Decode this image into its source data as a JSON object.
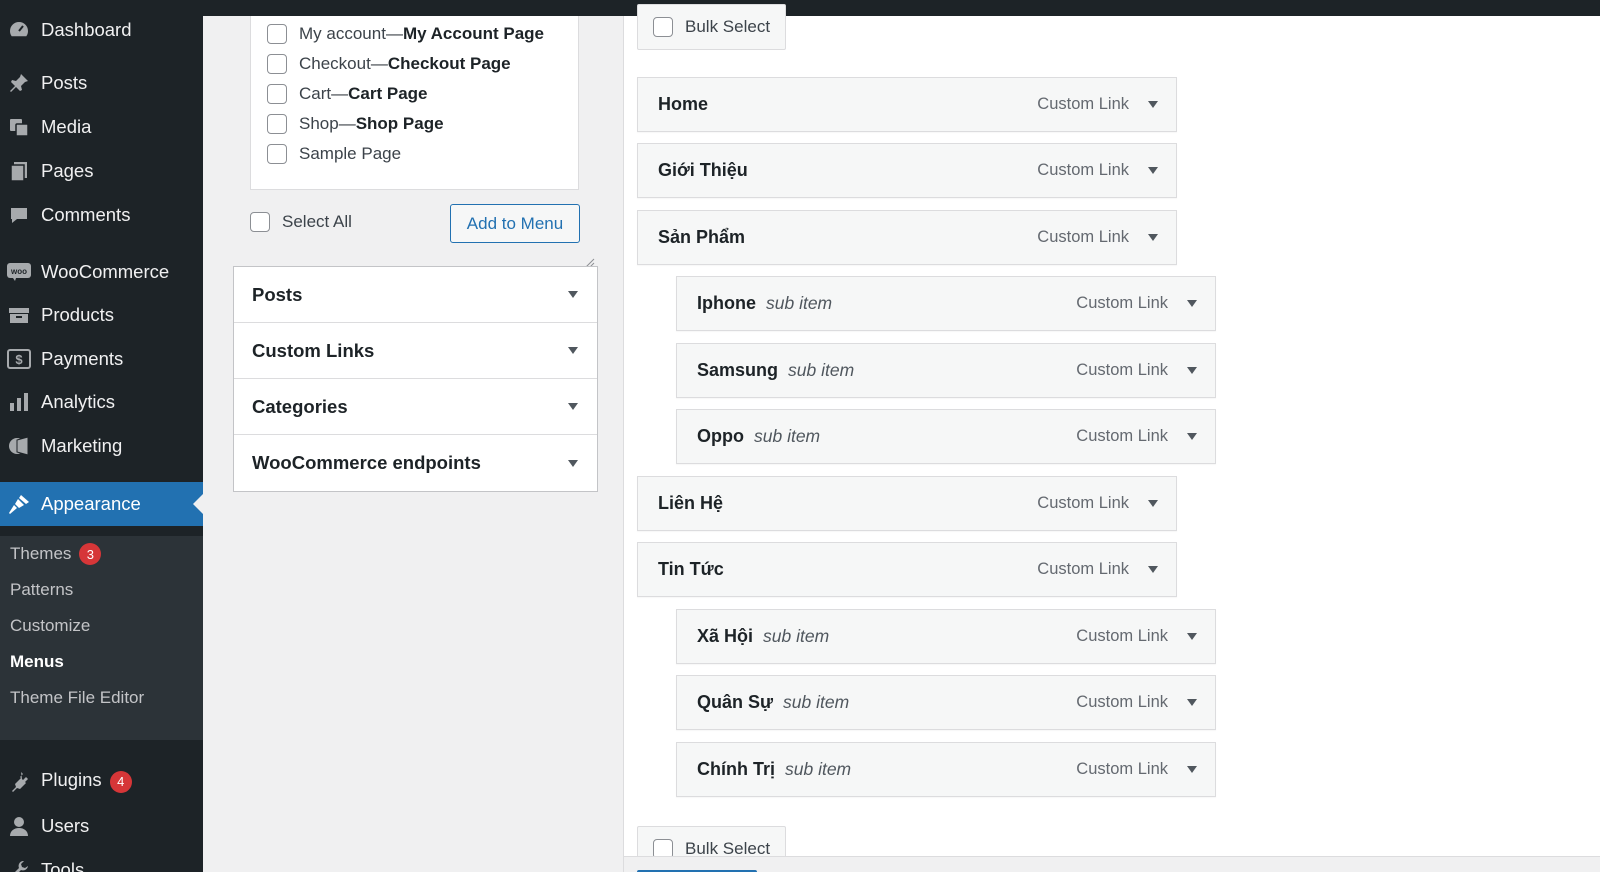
{
  "sidebar": {
    "items": [
      {
        "label": "Dashboard",
        "icon": "dashboard-icon"
      },
      {
        "label": "Posts",
        "icon": "pin-icon"
      },
      {
        "label": "Media",
        "icon": "media-icon"
      },
      {
        "label": "Pages",
        "icon": "pages-icon"
      },
      {
        "label": "Comments",
        "icon": "comment-icon"
      },
      {
        "label": "WooCommerce",
        "icon": "woo-icon"
      },
      {
        "label": "Products",
        "icon": "archive-icon"
      },
      {
        "label": "Payments",
        "icon": "dollar-icon"
      },
      {
        "label": "Analytics",
        "icon": "bar-chart-icon"
      },
      {
        "label": "Marketing",
        "icon": "megaphone-icon"
      },
      {
        "label": "Appearance",
        "icon": "brush-icon"
      },
      {
        "label": "Plugins",
        "icon": "plug-icon",
        "badge": "4"
      },
      {
        "label": "Users",
        "icon": "user-icon"
      },
      {
        "label": "Tools",
        "icon": "wrench-icon"
      }
    ],
    "submenu": [
      {
        "label": "Themes",
        "badge": "3"
      },
      {
        "label": "Patterns"
      },
      {
        "label": "Customize"
      },
      {
        "label": "Menus"
      },
      {
        "label": "Theme File Editor"
      }
    ]
  },
  "pages_panel": {
    "items": [
      {
        "name": "My account",
        "sep": " — ",
        "state": "My Account Page"
      },
      {
        "name": "Checkout",
        "sep": " — ",
        "state": "Checkout Page"
      },
      {
        "name": "Cart",
        "sep": " — ",
        "state": "Cart Page"
      },
      {
        "name": "Shop",
        "sep": " — ",
        "state": "Shop Page"
      },
      {
        "name": "Sample Page"
      }
    ],
    "select_all": "Select All",
    "add_button": "Add to Menu"
  },
  "accordion": [
    "Posts",
    "Custom Links",
    "Categories",
    "WooCommerce endpoints"
  ],
  "menu_structure": {
    "bulk_select": "Bulk Select",
    "items": [
      {
        "title": "Home",
        "type": "Custom Link",
        "depth": 0
      },
      {
        "title": "Giới Thiệu",
        "type": "Custom Link",
        "depth": 0
      },
      {
        "title": "Sản Phẩm",
        "type": "Custom Link",
        "depth": 0
      },
      {
        "title": "Iphone",
        "sub": "sub item",
        "type": "Custom Link",
        "depth": 1
      },
      {
        "title": "Samsung",
        "sub": "sub item",
        "type": "Custom Link",
        "depth": 1
      },
      {
        "title": "Oppo",
        "sub": "sub item",
        "type": "Custom Link",
        "depth": 1
      },
      {
        "title": "Liên Hệ",
        "type": "Custom Link",
        "depth": 0
      },
      {
        "title": "Tin Tức",
        "type": "Custom Link",
        "depth": 0
      },
      {
        "title": "Xã Hội",
        "sub": "sub item",
        "type": "Custom Link",
        "depth": 1
      },
      {
        "title": "Quân Sự",
        "sub": "sub item",
        "type": "Custom Link",
        "depth": 1
      },
      {
        "title": "Chính Trị",
        "sub": "sub item",
        "type": "Custom Link",
        "depth": 1
      }
    ]
  },
  "colors": {
    "sidebar_bg": "#1d2327",
    "submenu_bg": "#2c3338",
    "accent": "#2271b1",
    "badge": "#d63638"
  }
}
